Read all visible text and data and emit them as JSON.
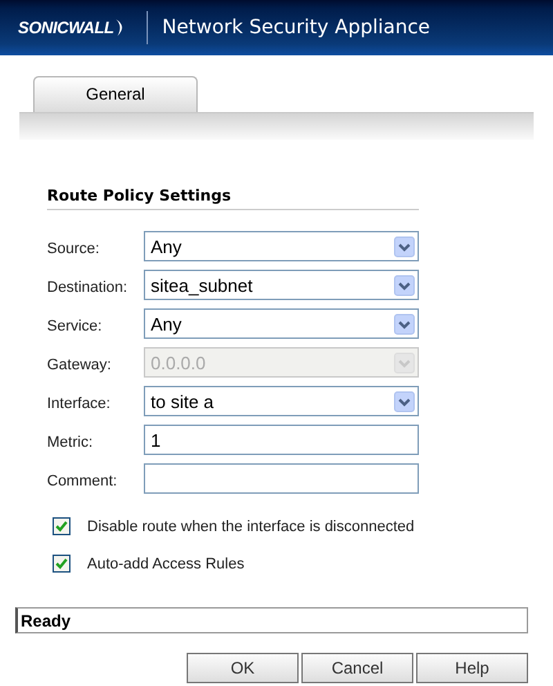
{
  "header": {
    "logo": "SONICWALL",
    "title": "Network Security Appliance"
  },
  "tabs": [
    {
      "label": "General",
      "selected": true
    }
  ],
  "section": {
    "title": "Route Policy Settings"
  },
  "fields": [
    {
      "label": "Source:",
      "kind": "select",
      "value": "Any",
      "disabled": false
    },
    {
      "label": "Destination:",
      "kind": "select",
      "value": "sitea_subnet",
      "disabled": false
    },
    {
      "label": "Service:",
      "kind": "select",
      "value": "Any",
      "disabled": false
    },
    {
      "label": "Gateway:",
      "kind": "select",
      "value": "0.0.0.0",
      "disabled": true
    },
    {
      "label": "Interface:",
      "kind": "select",
      "value": "to site a",
      "disabled": false
    },
    {
      "label": "Metric:",
      "kind": "text",
      "value": "1",
      "disabled": false
    },
    {
      "label": "Comment:",
      "kind": "text",
      "disabled": false
    }
  ],
  "options": [
    {
      "label": "Disable route when the interface is disconnected",
      "checked": true
    },
    {
      "label": "Auto-add Access Rules",
      "checked": true
    }
  ],
  "status_bar": "Ready",
  "buttons": [
    "OK",
    "Cancel",
    "Help"
  ]
}
